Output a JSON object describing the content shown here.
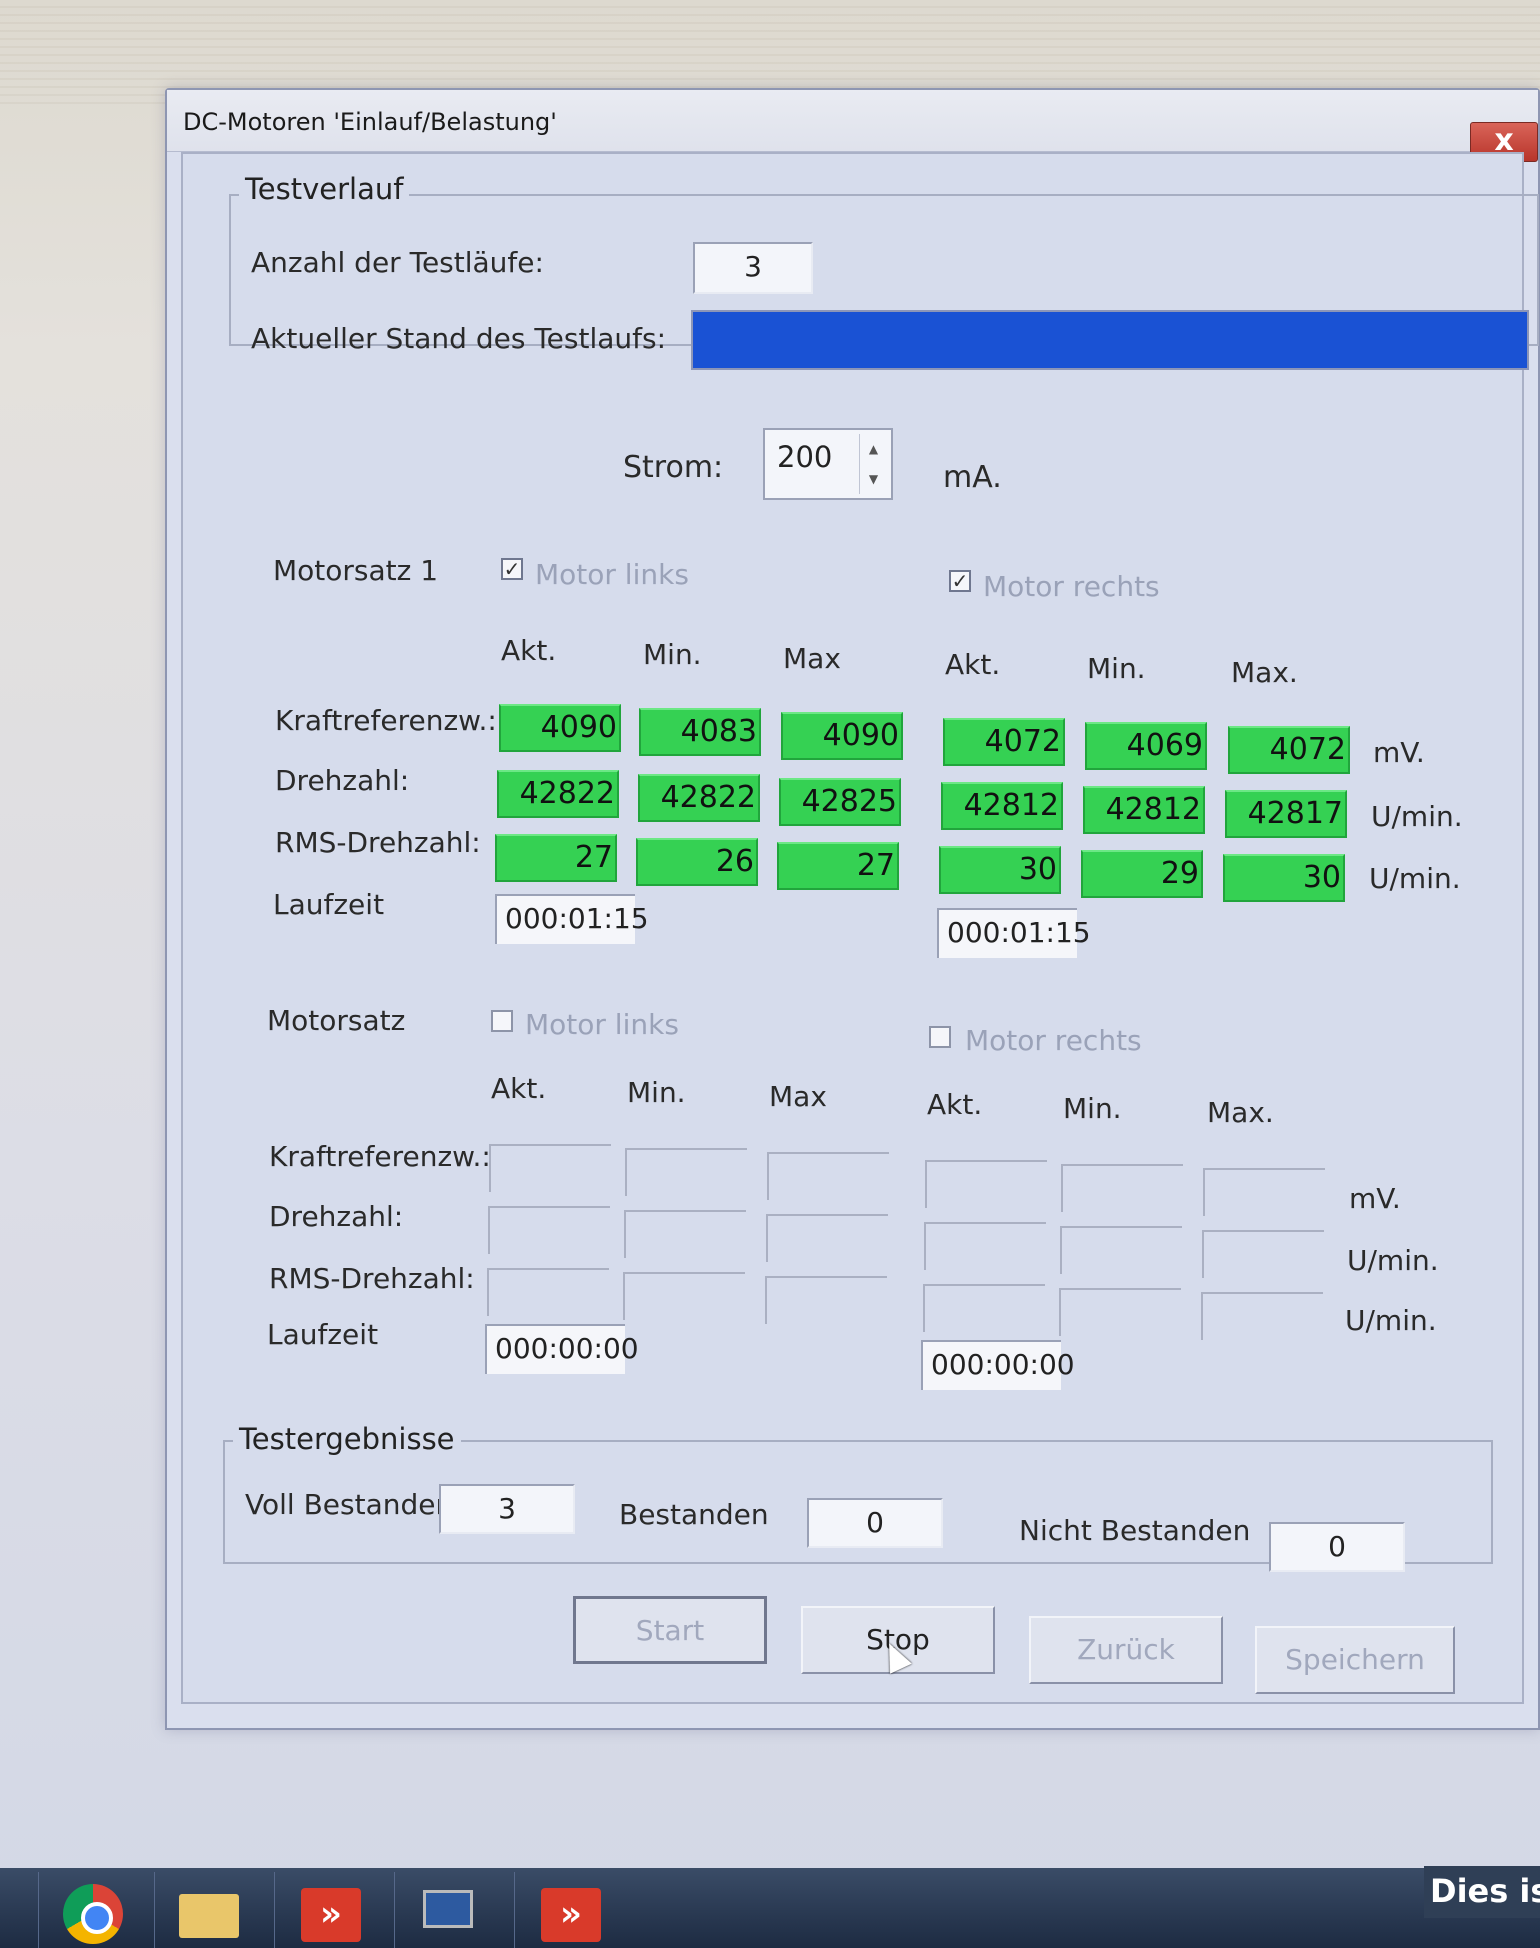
{
  "window": {
    "title": "DC-Motoren 'Einlauf/Belastung'",
    "close": "x"
  },
  "testverlauf": {
    "title": "Testverlauf",
    "anzahl_label": "Anzahl der Testläufe:",
    "anzahl_value": "3",
    "stand_label": "Aktueller Stand des Testlaufs:",
    "progress": 1.0
  },
  "strom": {
    "label": "Strom:",
    "value": "200",
    "unit": "mA."
  },
  "columns": {
    "akt": "Akt.",
    "min": "Min.",
    "max_left": "Max",
    "max_right": "Max."
  },
  "row_labels": {
    "kraft": "Kraftreferenzw.:",
    "drehzahl": "Drehzahl:",
    "rms": "RMS-Drehzahl:",
    "laufzeit": "Laufzeit"
  },
  "units": {
    "mv": "mV.",
    "umin": "U/min."
  },
  "motorsatz1": {
    "label": "Motorsatz 1",
    "links_label": "Motor links",
    "links_checked": true,
    "rechts_label": "Motor rechts",
    "rechts_checked": true,
    "left": {
      "kraft": [
        "4090",
        "4083",
        "4090"
      ],
      "drehzahl": [
        "42822",
        "42822",
        "42825"
      ],
      "rms": [
        "27",
        "26",
        "27"
      ],
      "laufzeit": "000:01:15"
    },
    "right": {
      "kraft": [
        "4072",
        "4069",
        "4072"
      ],
      "drehzahl": [
        "42812",
        "42812",
        "42817"
      ],
      "rms": [
        "30",
        "29",
        "30"
      ],
      "laufzeit": "000:01:15"
    }
  },
  "motorsatz2": {
    "label": "Motorsatz",
    "links_label": "Motor links",
    "links_checked": false,
    "rechts_label": "Motor rechts",
    "rechts_checked": false,
    "left_laufzeit": "000:00:00",
    "right_laufzeit": "000:00:00"
  },
  "testergebnisse": {
    "title": "Testergebnisse",
    "voll_label": "Voll Bestanden",
    "voll_value": "3",
    "bestanden_label": "Bestanden",
    "bestanden_value": "0",
    "nicht_label": "Nicht Bestanden",
    "nicht_value": "0"
  },
  "buttons": {
    "start": "Start",
    "stop": "Stop",
    "zurueck": "Zurück",
    "speichern": "Speichern"
  },
  "taskbar": {
    "notice": "Dies ist"
  }
}
